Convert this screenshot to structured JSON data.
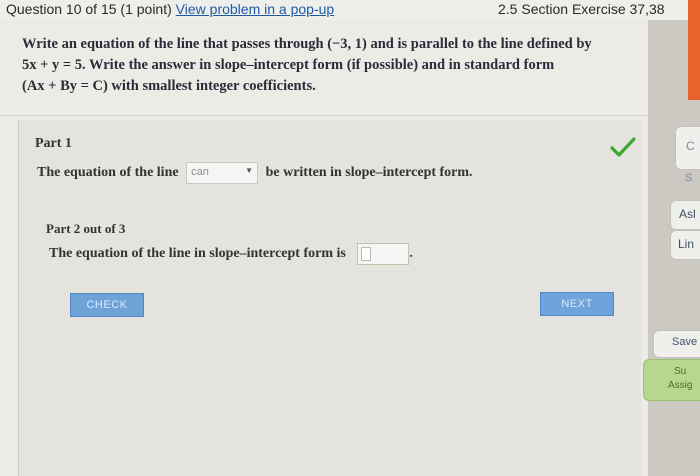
{
  "header": {
    "question_info": "Question 10 of 15 (1 point)",
    "popup_link": "View problem in a pop-up",
    "section": "2.5 Section Exercise 37,38"
  },
  "prompt": {
    "line1": "Write an equation of the line that passes through (−3, 1) and is parallel to the line defined by",
    "line2": "5x + y = 5. Write the answer in slope–intercept form (if possible) and in standard form",
    "line3": "(Ax + By = C) with smallest integer coefficients."
  },
  "part1": {
    "title": "Part 1",
    "sentence_before": "The equation of the line",
    "dropdown_value": "can",
    "sentence_after": "be written in slope–intercept form.",
    "status_icon": "checkmark-icon",
    "status_color": "#3aa82c"
  },
  "part2": {
    "title": "Part 2 out of 3",
    "sentence": "The equation of the line in slope–intercept form is",
    "input_value": ""
  },
  "buttons": {
    "check": "CHECK",
    "next": "NEXT"
  },
  "sidebar": {
    "c_label": "C",
    "s_label": "S",
    "ask_label": "Asl",
    "lin_label": "Lin",
    "save_label": "Save",
    "submit_line1": "Su",
    "submit_line2": "Assig"
  },
  "colors": {
    "accent_button": "#6ea3d8",
    "link": "#1e5aa8",
    "submit_green": "#b6d88e",
    "orange_tab": "#e7622d"
  }
}
